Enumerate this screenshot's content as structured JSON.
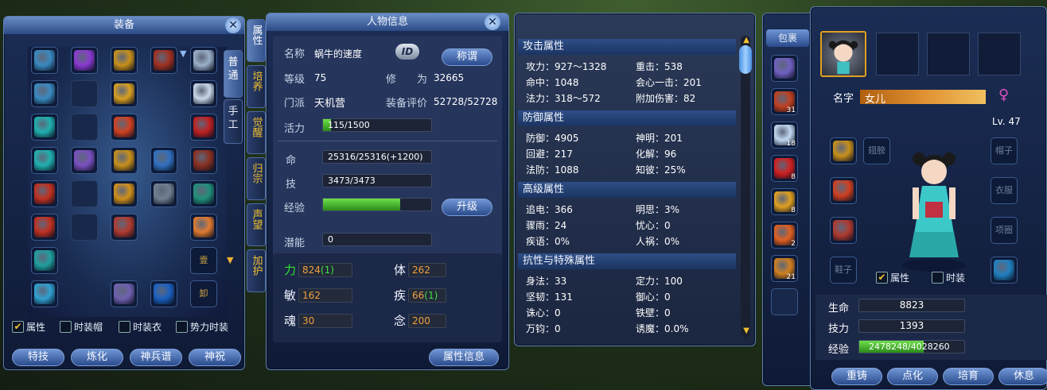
{
  "equip_panel": {
    "title": "装备",
    "side_tabs": [
      "普通",
      "手工"
    ],
    "slots": [
      {
        "row": 0,
        "col": 0,
        "color": "#3a8ac0"
      },
      {
        "row": 0,
        "col": 1,
        "color": "#8a3ad0"
      },
      {
        "row": 0,
        "col": 2,
        "color": "#c8901a"
      },
      {
        "row": 0,
        "col": 3,
        "color": "#a03020"
      },
      {
        "row": 0,
        "col": 4,
        "color": "#9ab0c8"
      },
      {
        "row": 1,
        "col": 0,
        "color": "#3a8ac0"
      },
      {
        "row": 1,
        "col": 2,
        "color": "#d8a020"
      },
      {
        "row": 1,
        "col": 4,
        "color": "#c8d8e8"
      },
      {
        "row": 2,
        "col": 0,
        "color": "#20b0b0"
      },
      {
        "row": 2,
        "col": 1,
        "color": "#4a5a7a"
      },
      {
        "row": 2,
        "col": 2,
        "color": "#d04020"
      },
      {
        "row": 2,
        "col": 4,
        "color": "#c02020"
      },
      {
        "row": 3,
        "col": 0,
        "color": "#20b0b0"
      },
      {
        "row": 3,
        "col": 1,
        "color": "#7a50c0"
      },
      {
        "row": 3,
        "col": 2,
        "color": "#c8901a"
      },
      {
        "row": 3,
        "col": 3,
        "color": "#3070c0"
      },
      {
        "row": 3,
        "col": 4,
        "color": "#8a3020"
      },
      {
        "row": 4,
        "col": 0,
        "color": "#c03020"
      },
      {
        "row": 4,
        "col": 2,
        "color": "#d0901a"
      },
      {
        "row": 4,
        "col": 3,
        "color": "#708090"
      },
      {
        "row": 4,
        "col": 4,
        "color": "#20907a"
      },
      {
        "row": 5,
        "col": 0,
        "color": "#c03020"
      },
      {
        "row": 5,
        "col": 2,
        "color": "#b03a30"
      },
      {
        "row": 5,
        "col": 4,
        "color": "#e07a30"
      },
      {
        "row": 6,
        "col": 0,
        "color": "#20a0a0"
      },
      {
        "row": 6,
        "col": 4,
        "color": "#8a6020"
      },
      {
        "row": 7,
        "col": 0,
        "color": "#30a0d0"
      },
      {
        "row": 7,
        "col": 2,
        "color": "#7060b0"
      },
      {
        "row": 7,
        "col": 3,
        "color": "#1a60c0"
      },
      {
        "row": 7,
        "col": 4,
        "color": "#a08020"
      }
    ],
    "empty_slot_label_1": "",
    "checkboxes": [
      {
        "label": "属性",
        "checked": true
      },
      {
        "label": "时装帽",
        "checked": false
      },
      {
        "label": "时装衣",
        "checked": false
      },
      {
        "label": "势力时装",
        "checked": false
      }
    ],
    "buttons": [
      "特技",
      "炼化",
      "神兵谱",
      "神祝"
    ],
    "unload_label": "卸",
    "stone_label": "壹"
  },
  "side_tabs": [
    "属性",
    "培养",
    "觉醒",
    "归宗",
    "声望",
    "加护"
  ],
  "char_panel": {
    "title": "人物信息",
    "name_label": "名称",
    "name": "蜗牛的速度",
    "id_badge": "ID",
    "title_btn": "称谓",
    "level_label": "等级",
    "level": "75",
    "cult_label": "修　　为",
    "cult": "32665",
    "sect_label": "门派",
    "sect": "天机营",
    "rating_label": "装备评价",
    "rating": "52728/52728",
    "vigor_label": "活力",
    "vigor": "115/1500",
    "vigor_pct": 7.7,
    "hp_label": "命",
    "hp": "25316/25316(+1200)",
    "skill_label": "技",
    "skill": "3473/3473",
    "exp_label": "经验",
    "exp_pct": 71,
    "levelup_btn": "升级",
    "potential_label": "潜能",
    "potential": "0",
    "stats": [
      {
        "label": "力",
        "value": "824",
        "bonus": "(1)",
        "green": true
      },
      {
        "label": "体",
        "value": "262",
        "bonus": ""
      },
      {
        "label": "敏",
        "value": "162",
        "bonus": ""
      },
      {
        "label": "疾",
        "value": "66",
        "bonus": "(1)"
      },
      {
        "label": "魂",
        "value": "30",
        "bonus": ""
      },
      {
        "label": "念",
        "value": "200",
        "bonus": ""
      }
    ],
    "attr_btn": "属性信息"
  },
  "attr_panel": {
    "sections": [
      {
        "title": "攻击属性",
        "rows": [
          [
            "攻力：927～1328",
            "重击：538"
          ],
          [
            "命中：1048",
            "会心一击：201"
          ],
          [
            "法力：318～572",
            "附加伤害：82"
          ]
        ]
      },
      {
        "title": "防御属性",
        "rows": [
          [
            "防御：4905",
            "神明：201"
          ],
          [
            "回避：217",
            "化解：96"
          ],
          [
            "法防：1088",
            "知彼：25%"
          ]
        ]
      },
      {
        "title": "高级属性",
        "rows": [
          [
            "追电：366",
            "明思：3%"
          ],
          [
            "骤雨：24",
            "忧心：0"
          ],
          [
            "疾语：0%",
            "人祸：0%"
          ]
        ]
      },
      {
        "title": "抗性与特殊属性",
        "rows": [
          [
            "身法：33",
            "定力：100"
          ],
          [
            "坚韧：131",
            "御心：0"
          ],
          [
            "诛心：0",
            "铁壁：0"
          ],
          [
            "万钧：0",
            "诱魔：0.0%"
          ]
        ]
      }
    ]
  },
  "bag": {
    "tab": "包裹",
    "items": [
      {
        "color": "#7060c0",
        "count": ""
      },
      {
        "color": "#c04020",
        "count": "31"
      },
      {
        "color": "#c0d8f0",
        "count": "18"
      },
      {
        "color": "#d02020",
        "count": "8"
      },
      {
        "color": "#e0a020",
        "count": "8"
      },
      {
        "color": "#e06020",
        "count": "2"
      },
      {
        "color": "#d08020",
        "count": "21"
      }
    ]
  },
  "pet_panel": {
    "name_label": "名字",
    "name": "女儿",
    "gender_icon": "♀",
    "level": "Lv. 47",
    "left_slots": [
      {
        "color": "#c8901a"
      },
      {
        "color": "#d04020"
      },
      {
        "color": "#b03a30"
      },
      {
        "text": "鞋子"
      }
    ],
    "right_slots": [
      {
        "text": "帽子"
      },
      {
        "text": "衣服"
      },
      {
        "text": "项圈"
      },
      {
        "color": "#2080c0"
      }
    ],
    "wing_slot": "翅膀",
    "checkboxes": [
      {
        "label": "属性",
        "checked": true
      },
      {
        "label": "时装",
        "checked": false
      }
    ],
    "hp_label": "生命",
    "hp": "8823",
    "skill_label": "技力",
    "skill": "1393",
    "exp_label": "经验",
    "exp": "2478248/4028260",
    "exp_pct": 61.5,
    "buttons": [
      "重铸",
      "点化",
      "培育",
      "休息"
    ]
  }
}
